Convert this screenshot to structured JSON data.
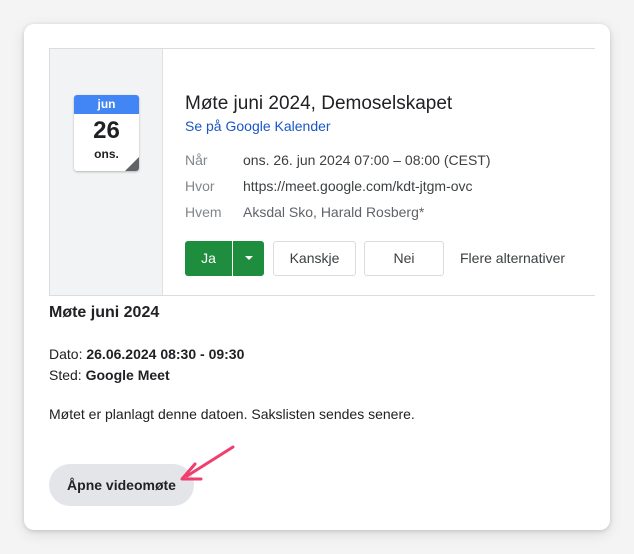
{
  "calendar_icon": {
    "month": "jun",
    "day": "26",
    "weekday": "ons.",
    "accent_color": "#4285f4"
  },
  "event": {
    "title": "Møte juni 2024, Demoselskapet",
    "calendar_link": "Se på Google Kalender",
    "details": [
      {
        "label": "Når",
        "value": "ons. 26. jun 2024 07:00 – 08:00 (CEST)"
      },
      {
        "label": "Hvor",
        "value": "https://meet.google.com/kdt-jtgm-ovc"
      },
      {
        "label": "Hvem",
        "value": "Aksdal Sko, Harald Rosberg*"
      }
    ]
  },
  "rsvp": {
    "yes_label": "Ja",
    "maybe_label": "Kanskje",
    "no_label": "Nei",
    "more_label": "Flere alternativer",
    "yes_color": "#1e8e3e"
  },
  "description": {
    "title": "Møte juni 2024",
    "date_label": "Dato:",
    "date_value": "26.06.2024 08:30 - 09:30",
    "place_label": "Sted:",
    "place_value": "Google Meet",
    "note": "Møtet er planlagt denne datoen. Sakslisten sendes senere."
  },
  "video_button": {
    "label": "Åpne videomøte"
  },
  "annotation": {
    "arrow_color": "#f03e6e"
  }
}
